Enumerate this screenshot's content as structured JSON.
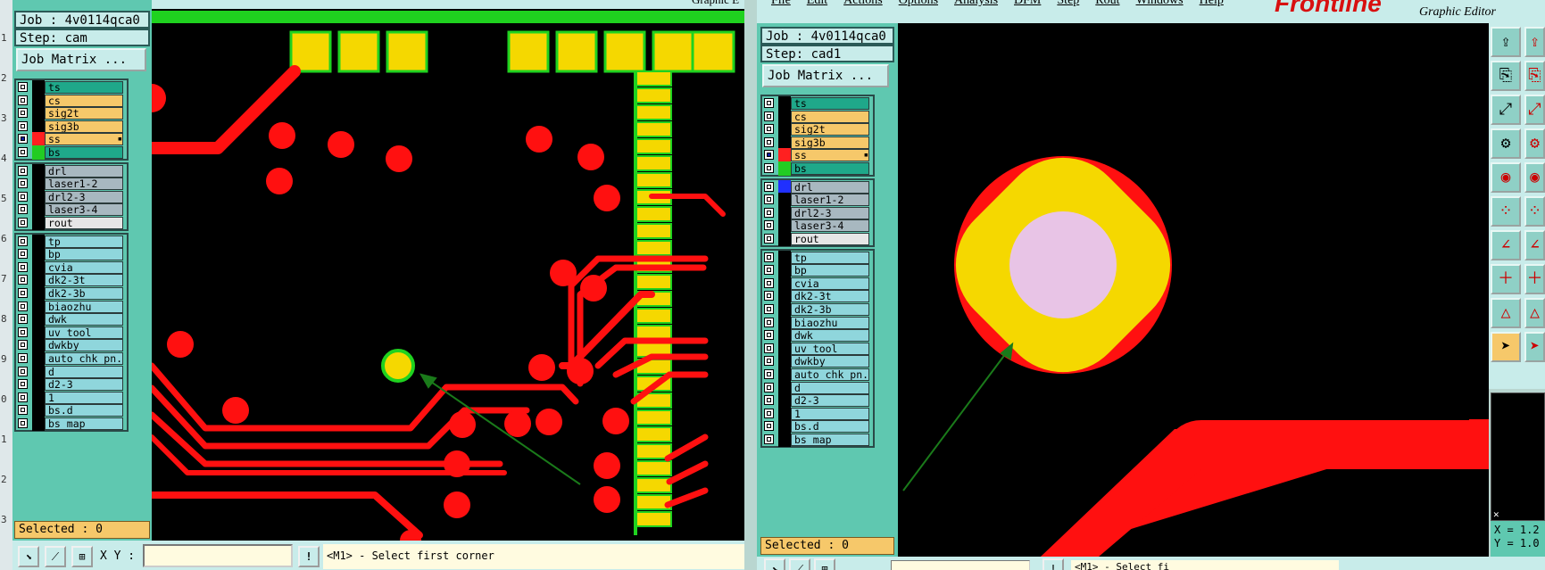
{
  "left_window": {
    "job": "Job : 4v0114qca0",
    "step": "Step: cam",
    "job_matrix_label": "Job Matrix ...",
    "selected": "Selected : 0",
    "xy_label": "X Y :",
    "xy_value": "",
    "prompt": "<M1> - Select first corner",
    "title_fragment": "Graphic E"
  },
  "right_window": {
    "job": "Job : 4v0114qca0",
    "step": "Step: cad1",
    "job_matrix_label": "Job Matrix ...",
    "selected": "Selected : 0",
    "menu": [
      "File",
      "Edit",
      "Actions",
      "Options",
      "Analysis",
      "DFM",
      "Step",
      "Rout",
      "Windows",
      "Help"
    ],
    "brand": "Frontline",
    "title": "Graphic Editor",
    "coord_x": "X = 1.2",
    "coord_y": "Y = 1.0",
    "prompt_fragment": "<M1> - Select fi"
  },
  "layers_left": [
    {
      "name": "ts",
      "color": "#1fa88a",
      "swatch": "#000000"
    },
    {
      "name": "cs",
      "color": "#f6c86a",
      "swatch": "#000000"
    },
    {
      "name": "sig2t",
      "color": "#f6c86a",
      "swatch": "#000000"
    },
    {
      "name": "sig3b",
      "color": "#f6c86a",
      "swatch": "#000000"
    },
    {
      "name": "ss",
      "color": "#f6c86a",
      "swatch": "#ff2020",
      "active": true
    },
    {
      "name": "bs",
      "color": "#1fa88a",
      "swatch": "#22cc22"
    },
    {
      "name": "drl",
      "color": "#a8b8c0",
      "swatch": "#000000"
    },
    {
      "name": "laser1-2",
      "color": "#a8b8c0",
      "swatch": "#000000"
    },
    {
      "name": "drl2-3",
      "color": "#a8b8c0",
      "swatch": "#000000"
    },
    {
      "name": "laser3-4",
      "color": "#a8b8c0",
      "swatch": "#000000"
    },
    {
      "name": "rout",
      "color": "#e6e6e6",
      "swatch": "#000000"
    },
    {
      "name": "tp",
      "color": "#8fd6dc",
      "swatch": "#000000"
    },
    {
      "name": "bp",
      "color": "#8fd6dc",
      "swatch": "#000000"
    },
    {
      "name": "cvia",
      "color": "#8fd6dc",
      "swatch": "#000000"
    },
    {
      "name": "dk2-3t",
      "color": "#8fd6dc",
      "swatch": "#000000"
    },
    {
      "name": "dk2-3b",
      "color": "#8fd6dc",
      "swatch": "#000000"
    },
    {
      "name": "biaozhu",
      "color": "#8fd6dc",
      "swatch": "#000000"
    },
    {
      "name": "dwk",
      "color": "#8fd6dc",
      "swatch": "#000000"
    },
    {
      "name": "uv_tool",
      "color": "#8fd6dc",
      "swatch": "#000000"
    },
    {
      "name": "dwkby",
      "color": "#8fd6dc",
      "swatch": "#000000"
    },
    {
      "name": "auto_chk_pn.",
      "color": "#8fd6dc",
      "swatch": "#000000"
    },
    {
      "name": "d",
      "color": "#8fd6dc",
      "swatch": "#000000"
    },
    {
      "name": "d2-3",
      "color": "#8fd6dc",
      "swatch": "#000000"
    },
    {
      "name": "1",
      "color": "#8fd6dc",
      "swatch": "#000000"
    },
    {
      "name": "bs.d",
      "color": "#8fd6dc",
      "swatch": "#000000"
    },
    {
      "name": "bs_map",
      "color": "#8fd6dc",
      "swatch": "#000000"
    }
  ],
  "layers_right": [
    {
      "name": "ts",
      "color": "#1fa88a",
      "swatch": "#000000"
    },
    {
      "name": "cs",
      "color": "#f6c86a",
      "swatch": "#000000"
    },
    {
      "name": "sig2t",
      "color": "#f6c86a",
      "swatch": "#000000"
    },
    {
      "name": "sig3b",
      "color": "#f6c86a",
      "swatch": "#000000"
    },
    {
      "name": "ss",
      "color": "#f6c86a",
      "swatch": "#ff2020",
      "active": true
    },
    {
      "name": "bs",
      "color": "#1fa88a",
      "swatch": "#22cc22"
    },
    {
      "name": "drl",
      "color": "#a8b8c0",
      "swatch": "#2030ff"
    },
    {
      "name": "laser1-2",
      "color": "#a8b8c0",
      "swatch": "#000000"
    },
    {
      "name": "drl2-3",
      "color": "#a8b8c0",
      "swatch": "#000000"
    },
    {
      "name": "laser3-4",
      "color": "#a8b8c0",
      "swatch": "#000000"
    },
    {
      "name": "rout",
      "color": "#e6e6e6",
      "swatch": "#000000"
    },
    {
      "name": "tp",
      "color": "#8fd6dc",
      "swatch": "#000000"
    },
    {
      "name": "bp",
      "color": "#8fd6dc",
      "swatch": "#000000"
    },
    {
      "name": "cvia",
      "color": "#8fd6dc",
      "swatch": "#000000"
    },
    {
      "name": "dk2-3t",
      "color": "#8fd6dc",
      "swatch": "#000000"
    },
    {
      "name": "dk2-3b",
      "color": "#8fd6dc",
      "swatch": "#000000"
    },
    {
      "name": "biaozhu",
      "color": "#8fd6dc",
      "swatch": "#000000"
    },
    {
      "name": "dwk",
      "color": "#8fd6dc",
      "swatch": "#000000"
    },
    {
      "name": "uv_tool",
      "color": "#8fd6dc",
      "swatch": "#000000"
    },
    {
      "name": "dwkby",
      "color": "#8fd6dc",
      "swatch": "#000000"
    },
    {
      "name": "auto_chk_pn.",
      "color": "#8fd6dc",
      "swatch": "#000000"
    },
    {
      "name": "d",
      "color": "#8fd6dc",
      "swatch": "#000000"
    },
    {
      "name": "d2-3",
      "color": "#8fd6dc",
      "swatch": "#000000"
    },
    {
      "name": "1",
      "color": "#8fd6dc",
      "swatch": "#000000"
    },
    {
      "name": "bs.d",
      "color": "#8fd6dc",
      "swatch": "#000000"
    },
    {
      "name": "bs_map",
      "color": "#8fd6dc",
      "swatch": "#000000"
    }
  ],
  "row_numbers": [
    "1",
    "2",
    "3",
    "4",
    "5",
    "6",
    "7",
    "8",
    "9",
    "0",
    "1",
    "2",
    "3"
  ],
  "colors": {
    "trace": "#ff1010",
    "pad": "#f5d800",
    "pad_outline": "#1fd21f",
    "hole": "#e8c4e6",
    "arrow": "#1a7a1a",
    "canvas": "#000000"
  },
  "tools": [
    "layer-up-icon",
    "layer-copy-icon",
    "fit-view-icon",
    "measure-icon",
    "snap-icon",
    "pin-icon",
    "draw-line-icon",
    "add-feature-icon",
    "triangle-icon",
    "pointer-icon"
  ]
}
